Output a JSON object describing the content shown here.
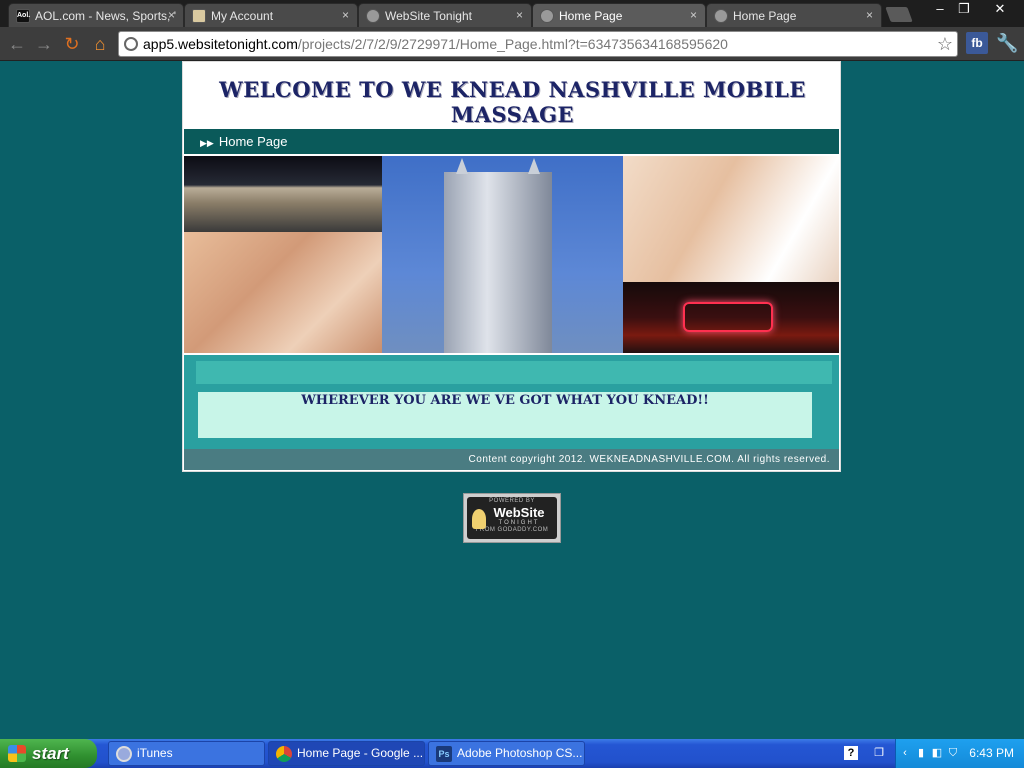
{
  "browser": {
    "tabs": [
      {
        "label": "AOL.com - News, Sports, '",
        "icon": "aol-icon"
      },
      {
        "label": "My Account",
        "icon": "account-icon"
      },
      {
        "label": "WebSite Tonight",
        "icon": "globe-icon"
      },
      {
        "label": "Home Page",
        "icon": "globe-icon"
      },
      {
        "label": "Home Page",
        "icon": "globe-icon"
      }
    ],
    "tab_close_glyph": "×",
    "window_controls": {
      "minimize": "–",
      "restore": "❐",
      "close": "✕"
    },
    "nav": {
      "back": "←",
      "forward": "→",
      "reload": "↻",
      "home": "⌂"
    },
    "address": {
      "host": "app5.websitetonight.com",
      "path": "/projects/2/7/2/9/2729971/Home_Page.html?t=634735634168595620"
    },
    "bookmark_star": "☆",
    "extension_fb": "fb",
    "wrench": "🔧"
  },
  "site": {
    "title": "WELCOME TO WE KNEAD NASHVILLE MOBILE MASSAGE",
    "nav": {
      "arrow": "▶▶",
      "label": "Home Page"
    },
    "slogan": "WHEREVER YOU ARE WE VE GOT WHAT YOU KNEAD!!",
    "footer": "Content copyright 2012. WEKNEADNASHVILLE.COM. All rights reserved.",
    "badge": {
      "top": "POWERED BY",
      "name": "WebSite",
      "sub": "TONIGHT",
      "bottom": "FROM GODADDY.COM"
    }
  },
  "taskbar": {
    "start": "start",
    "tasks": [
      {
        "label": "iTunes"
      },
      {
        "label": "Home Page - Google ..."
      },
      {
        "label": "Adobe Photoshop CS..."
      }
    ],
    "help": "?",
    "clock": "6:43 PM"
  },
  "colors": {
    "page_bg": "#0a6068",
    "title_text": "#1c2466",
    "nav_bar": "#0a5a5a",
    "teal_section": "#2aa0a0",
    "slogan_box": "#c8f5e8",
    "footer_bar": "#4a7c82"
  }
}
